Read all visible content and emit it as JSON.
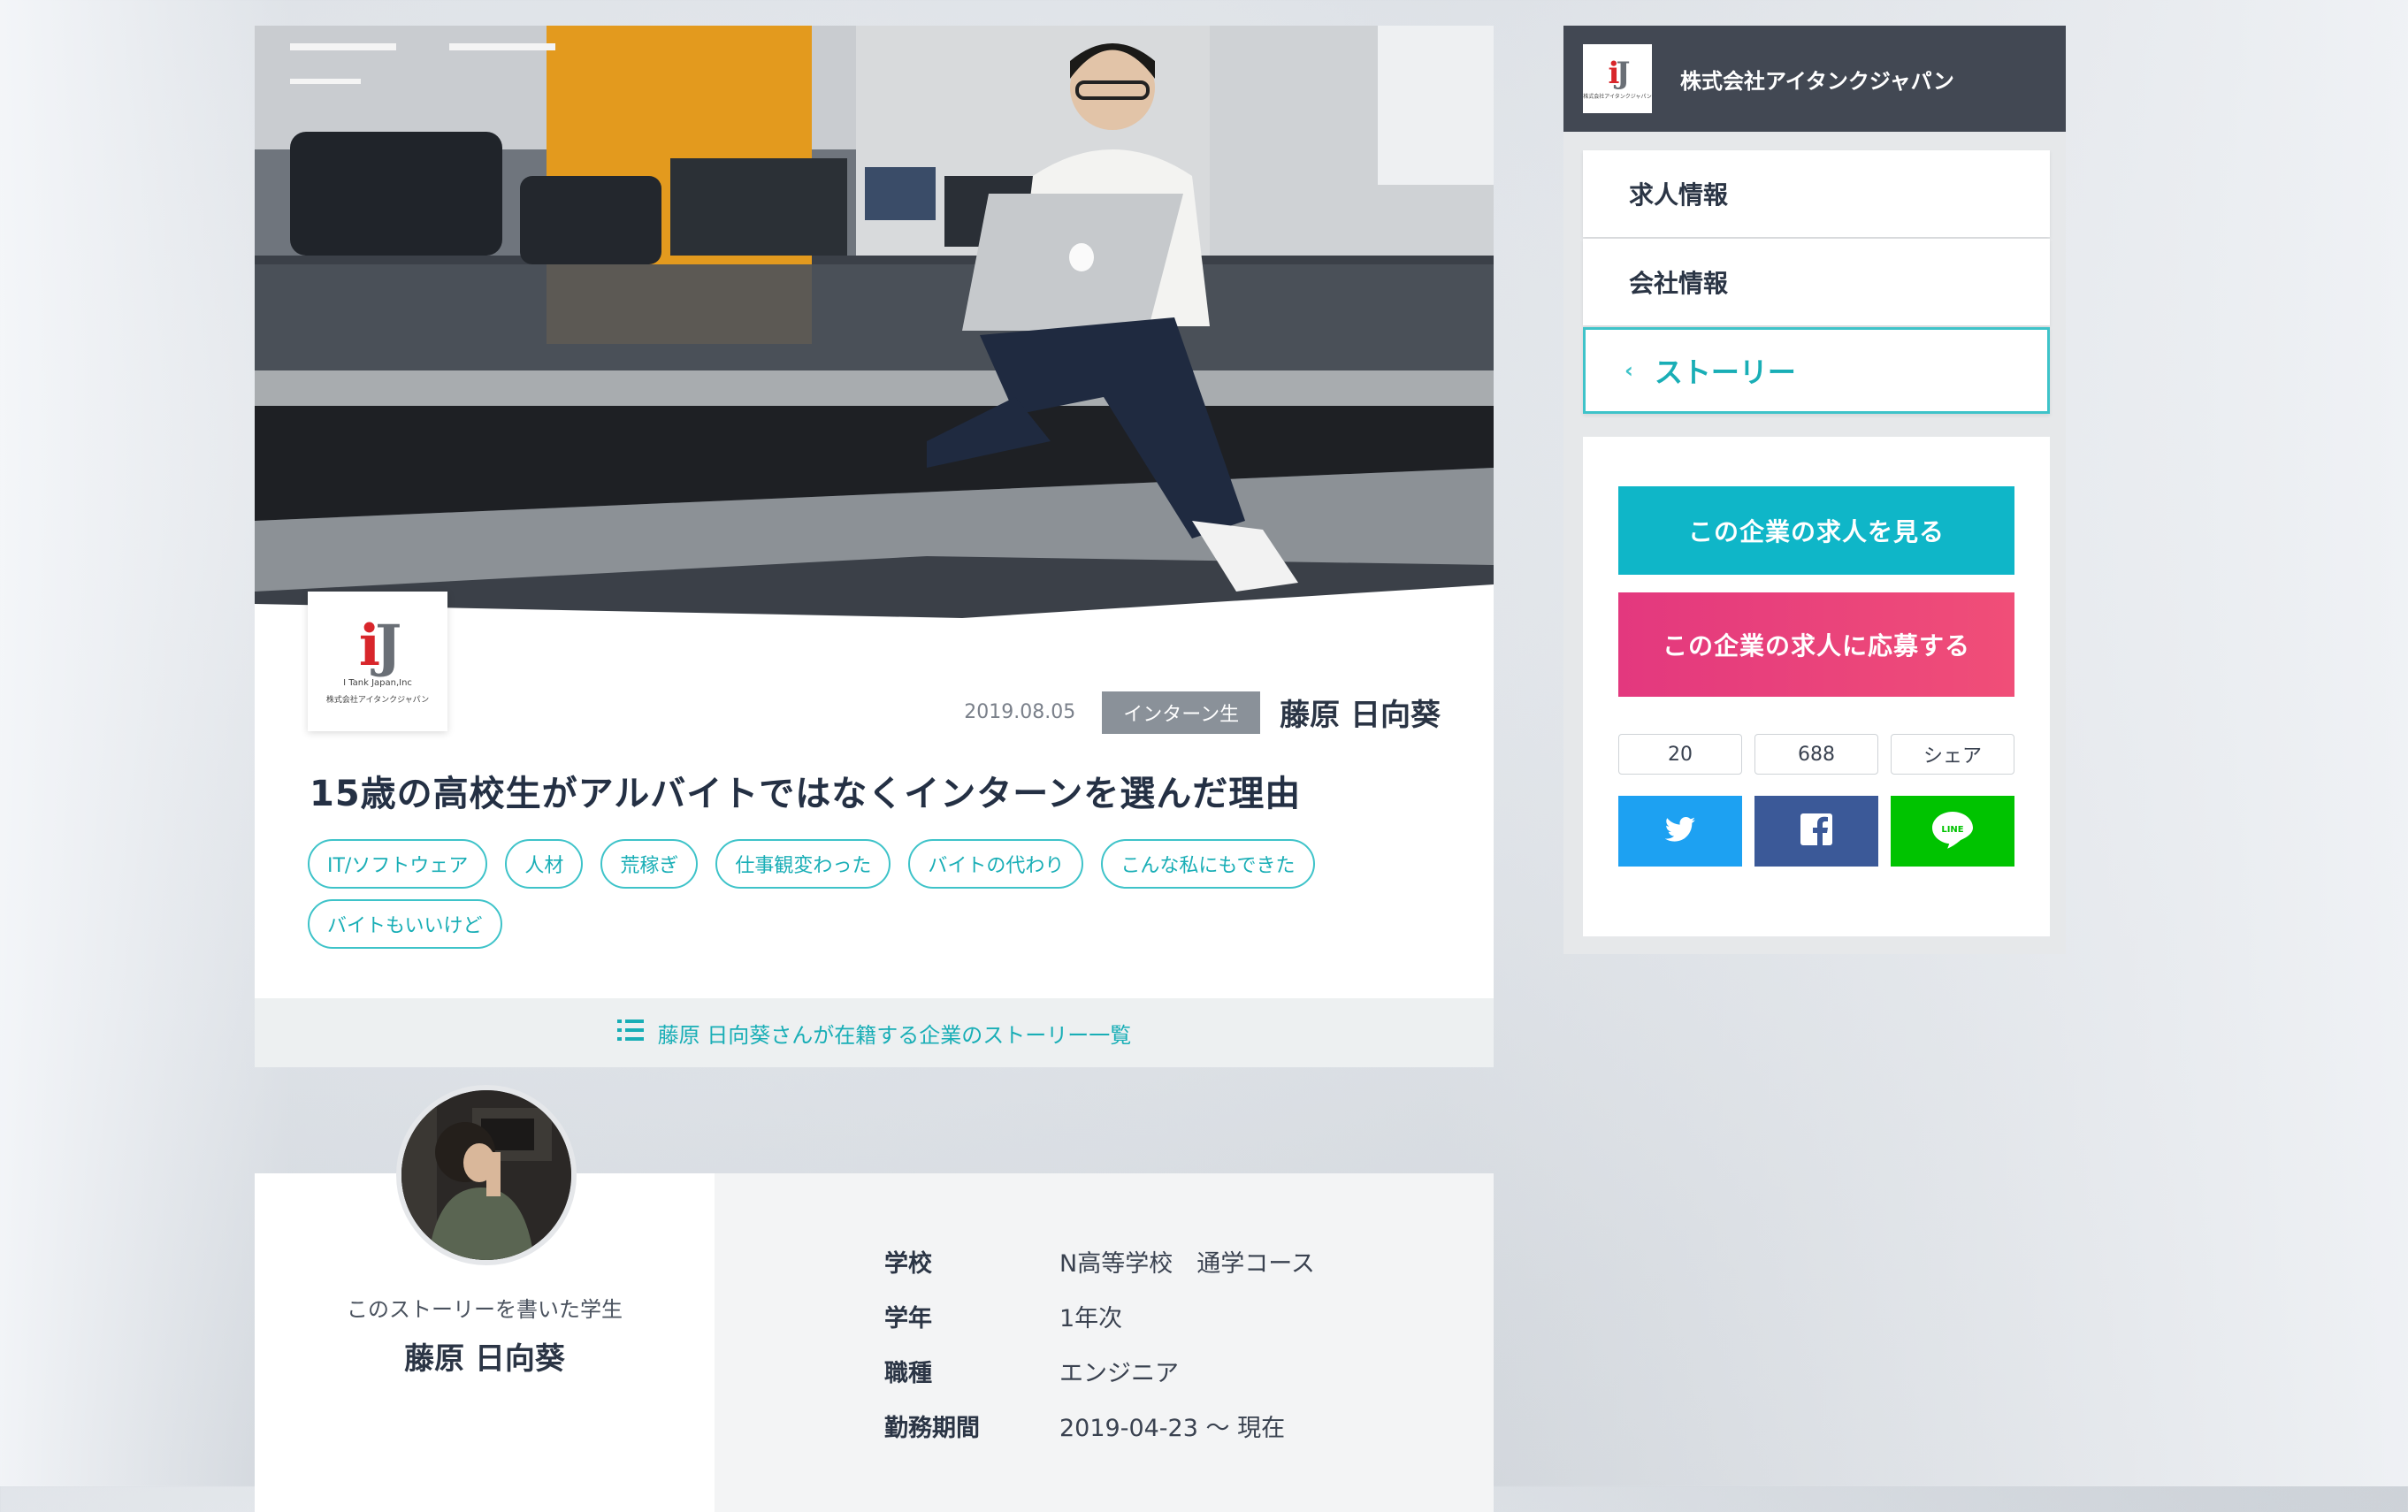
{
  "company": {
    "name": "株式会社アイタンクジャパン",
    "logo_mark": "iJ",
    "logo_en": "I Tank Japan,Inc",
    "logo_jp": "株式会社アイタンクジャパン"
  },
  "article": {
    "date": "2019.08.05",
    "role": "インターン生",
    "author": "藤原 日向葵",
    "title": "15歳の高校生がアルバイトではなくインターンを選んだ理由",
    "tags": [
      "IT/ソフトウェア",
      "人材",
      "荒稼ぎ",
      "仕事観変わった",
      "バイトの代わり",
      "こんな私にもできた",
      "バイトもいいけど"
    ],
    "story_list_link": "藤原 日向葵さんが在籍する企業のストーリー一覧"
  },
  "profile": {
    "caption": "このストーリーを書いた学生",
    "name": "藤原 日向葵",
    "rows": [
      {
        "label": "学校",
        "value": "N高等学校　通学コース"
      },
      {
        "label": "学年",
        "value": "1年次"
      },
      {
        "label": "職種",
        "value": "エンジニア"
      },
      {
        "label": "勤務期間",
        "value": "2019-04-23 〜 現在"
      }
    ]
  },
  "sidebar": {
    "nav": [
      {
        "label": "求人情報"
      },
      {
        "label": "会社情報"
      },
      {
        "label": "ストーリー",
        "active": true
      }
    ],
    "btn_view": "この企業の求人を見る",
    "btn_apply": "この企業の求人に応募する",
    "counts": [
      "20",
      "688",
      "シェア"
    ],
    "share_icons": [
      "twitter-icon",
      "facebook-icon",
      "line-icon"
    ],
    "line_text": "LINE"
  },
  "colors": {
    "accent": "#3ec3c9",
    "button_view": "#0fb6c8",
    "button_apply": "#e3387e",
    "twitter": "#1da1f2",
    "facebook": "#3b5998",
    "line": "#00c300",
    "sidebar_header": "#424853"
  }
}
